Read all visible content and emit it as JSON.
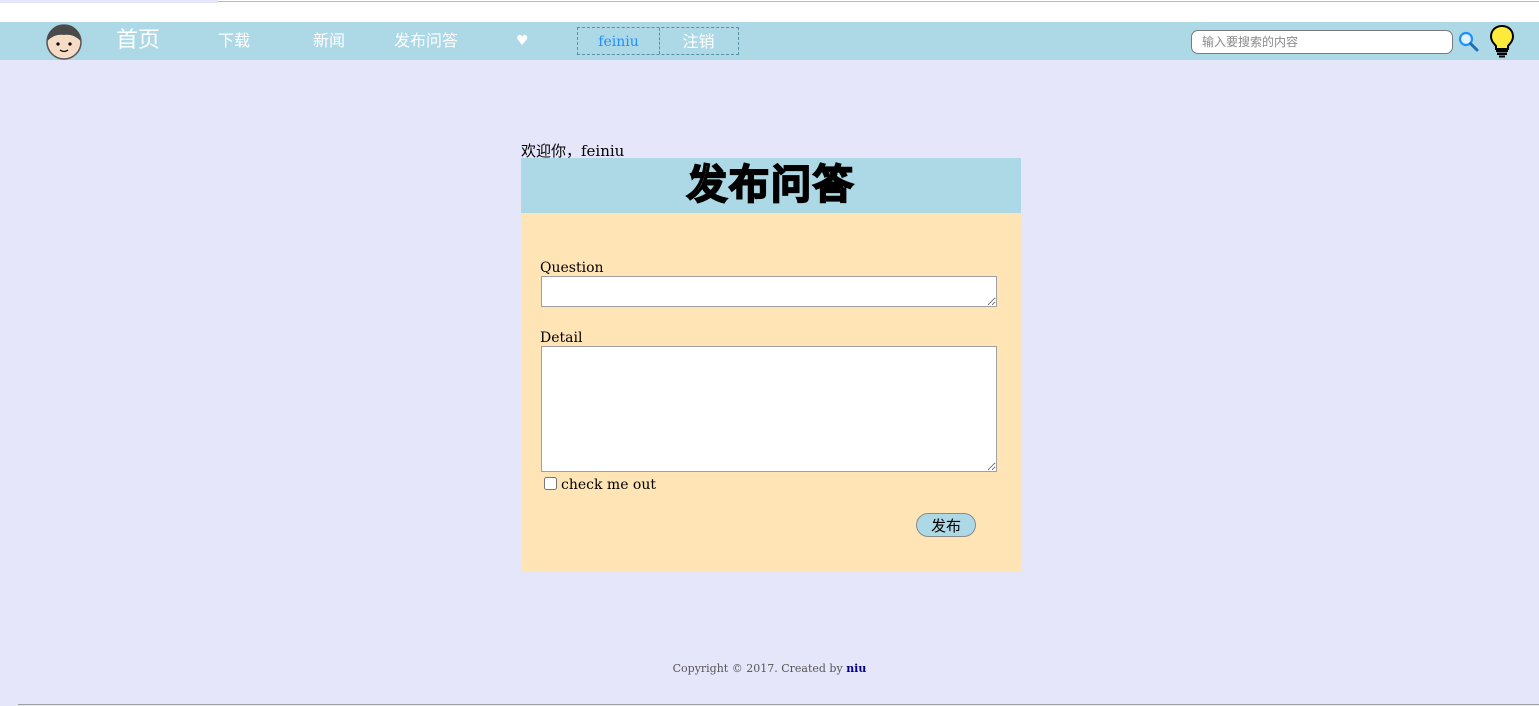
{
  "nav": {
    "home": "首页",
    "download": "下载",
    "news": "新闻",
    "publish": "发布问答",
    "heart": "♥",
    "username": "feiniu",
    "logout": "注销"
  },
  "search": {
    "placeholder": "输入要搜索的内容",
    "value": ""
  },
  "icons": {
    "avatar": "avatar-icon",
    "search": "search-icon",
    "bulb": "lightbulb-icon"
  },
  "welcome": "欢迎你，feiniu",
  "panel": {
    "title": "发布问答",
    "question_label": "Question",
    "question_value": "",
    "detail_label": "Detail",
    "detail_value": "",
    "check_label": "check me out",
    "checked": false,
    "submit_label": "发布"
  },
  "footer": {
    "text": "Copyright © 2017. Created by",
    "author": "niu"
  },
  "colors": {
    "navbar": "#add8e6",
    "page_bg": "#e6e6fa",
    "panel_body": "#ffe4b5",
    "username": "#1e90ff"
  }
}
